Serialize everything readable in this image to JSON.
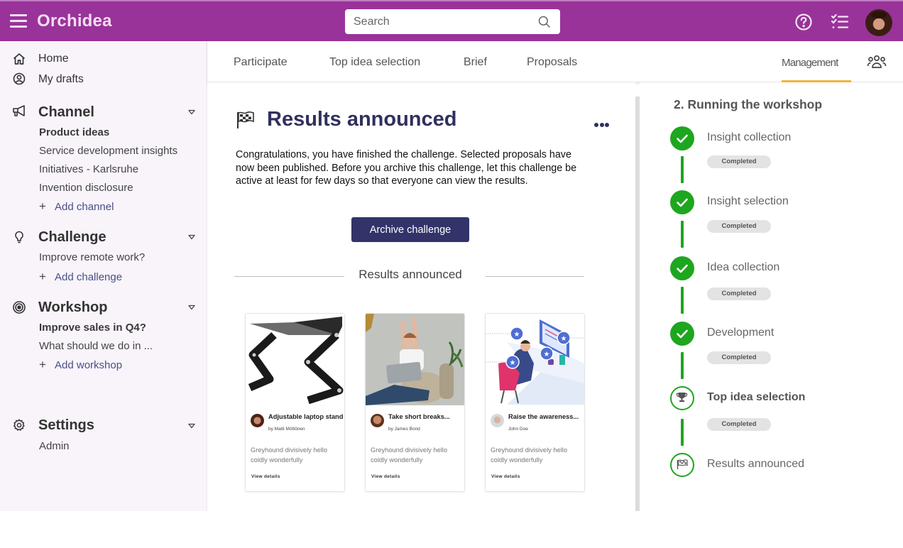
{
  "app": {
    "brand": "Orchidea",
    "search_placeholder": "Search",
    "colors": {
      "brand": "#993399",
      "accent_dark": "#33336a",
      "success": "#1ea61e",
      "tab_indicator": "#f2b33d"
    }
  },
  "header_icons": [
    "menu-icon",
    "help-icon",
    "task-list-icon",
    "user-avatar"
  ],
  "sidebar": {
    "top_links": [
      {
        "label": "Home",
        "icon": "home-icon"
      },
      {
        "label": "My drafts",
        "icon": "user-circle-icon"
      }
    ],
    "sections": [
      {
        "title": "Channel",
        "icon": "megaphone-icon",
        "items": [
          {
            "label": "Product ideas",
            "active": true
          },
          {
            "label": "Service development insights"
          },
          {
            "label": "Initiatives - Karlsruhe"
          },
          {
            "label": "Invention disclosure"
          }
        ],
        "add_label": "Add channel"
      },
      {
        "title": "Challenge",
        "icon": "lightbulb-icon",
        "items": [
          {
            "label": "Improve remote work?"
          }
        ],
        "add_label": "Add challenge"
      },
      {
        "title": "Workshop",
        "icon": "target-icon",
        "items": [
          {
            "label": "Improve sales in Q4?",
            "active": true
          },
          {
            "label": "What should we do in ..."
          }
        ],
        "add_label": "Add workshop"
      },
      {
        "title": "Settings",
        "icon": "gear-icon",
        "items": [
          {
            "label": "Admin"
          }
        ]
      }
    ]
  },
  "tabs": [
    {
      "label": "Participate"
    },
    {
      "label": "Top idea selection"
    },
    {
      "label": "Brief"
    },
    {
      "label": "Proposals"
    },
    {
      "label": "Management",
      "active": true
    }
  ],
  "main": {
    "title": "Results announced",
    "description": "Congratulations, you have finished the challenge. Selected proposals have now been published. Before you archive this challenge, let this challenge be active at least for few days so that everyone can view the results.",
    "archive_button": "Archive challenge",
    "divider_label": "Results announced",
    "cards": [
      {
        "title": "Adjustable laptop stand",
        "author": "by Matti Möttönen",
        "body": "Greyhound divisively hello coldly wonderfully",
        "link": "View details",
        "image": "laptop-stand-photo"
      },
      {
        "title": "Take short breaks...",
        "author": "by James Bond",
        "body": "Greyhound divisively hello coldly wonderfully",
        "link": "View details",
        "image": "stretching-woman-photo"
      },
      {
        "title": "Raise the awareness...",
        "author": "John Doe",
        "body": "Greyhound divisively hello coldly wonderfully",
        "link": "View details",
        "image": "ergonomic-desk-illustration"
      }
    ]
  },
  "workshop_panel": {
    "title": "2. Running the workshop",
    "steps": [
      {
        "label": "Insight collection",
        "status": "Completed",
        "icon": "check"
      },
      {
        "label": "Insight selection",
        "status": "Completed",
        "icon": "check"
      },
      {
        "label": "Idea collection",
        "status": "Completed",
        "icon": "check"
      },
      {
        "label": "Development",
        "status": "Completed",
        "icon": "check"
      },
      {
        "label": "Top idea selection",
        "status": "Completed",
        "icon": "trophy",
        "current": true
      },
      {
        "label": "Results announced",
        "icon": "checkered-flag"
      }
    ]
  }
}
